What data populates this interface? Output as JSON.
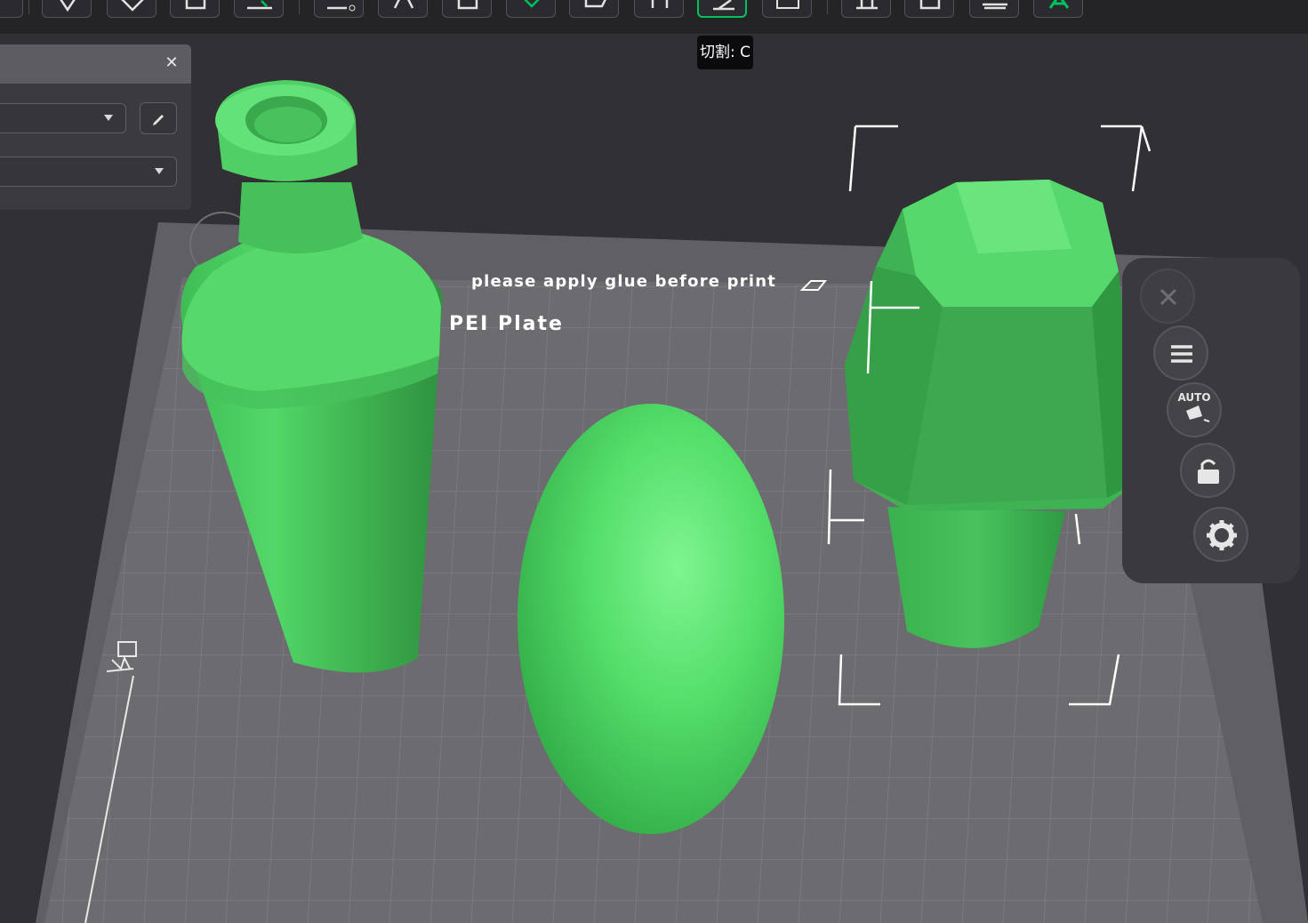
{
  "tooltip": {
    "text": "切割: C"
  },
  "plate": {
    "notice": "please apply glue before print",
    "name": "PEI Plate"
  },
  "side_tools": {
    "auto_label": "AUTO"
  },
  "toolbar": {
    "active_tool": "cut",
    "icons": [
      "add-icon",
      "orient-icon",
      "arrange-icon",
      "layer-icon",
      "support-paint-icon",
      "split-objects-icon",
      "split-parts-icon",
      "layers-icon",
      "variable-layer-icon",
      "seam-icon",
      "cut-icon",
      "measure-icon",
      "support-icon",
      "emboss-icon",
      "assembly-icon",
      "text-icon"
    ]
  },
  "colors": {
    "background": "#313135",
    "bed": "#6b6b70",
    "grid": "#8a8a8f",
    "model_green": "#4fd765",
    "accent": "#00c15e",
    "tooltip_bg": "#0b0b0d"
  }
}
